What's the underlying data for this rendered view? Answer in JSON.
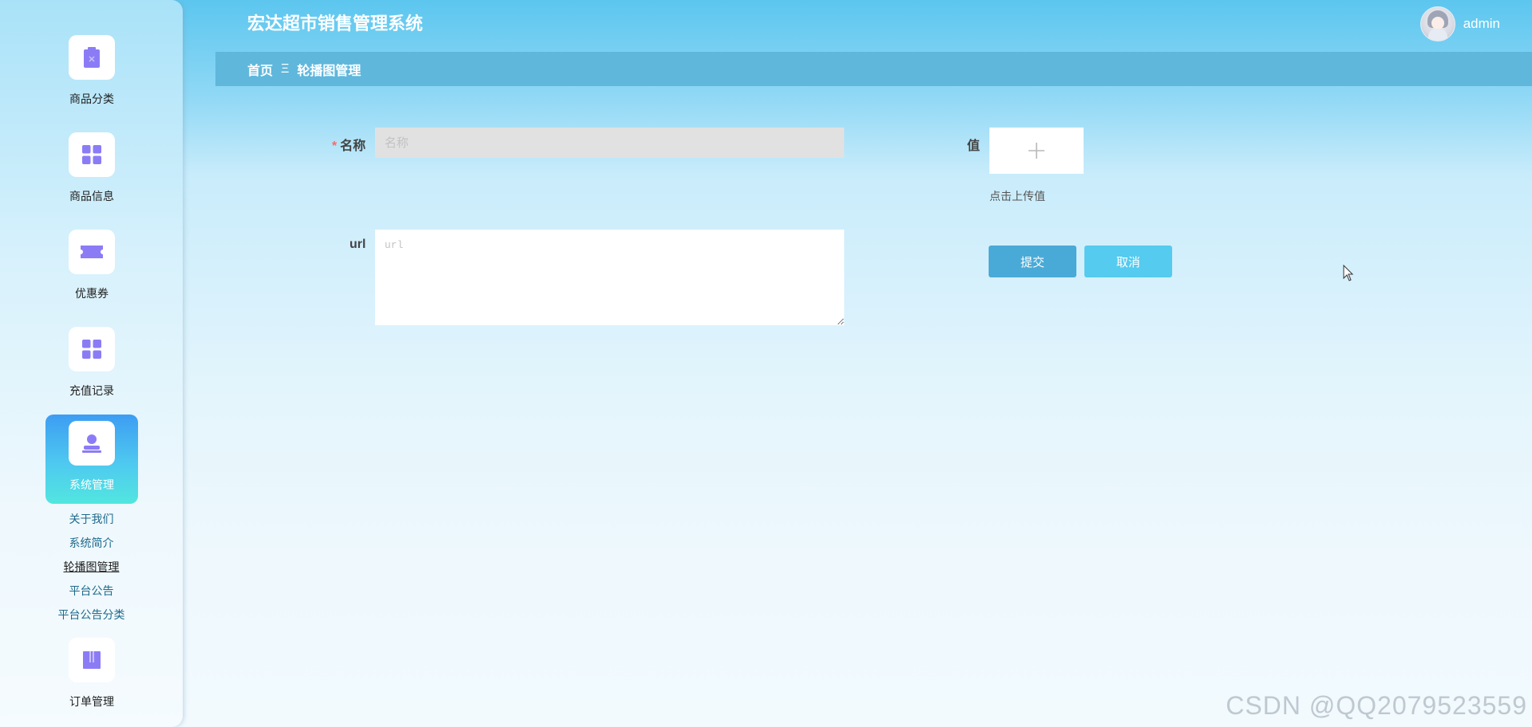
{
  "app": {
    "title": "宏达超市销售管理系统",
    "username": "admin"
  },
  "sidebar": {
    "items": [
      {
        "label": "商品分类",
        "icon": "clipboard-icon",
        "active": false
      },
      {
        "label": "商品信息",
        "icon": "grid-icon",
        "active": false
      },
      {
        "label": "优惠券",
        "icon": "ticket-icon",
        "active": false
      },
      {
        "label": "充值记录",
        "icon": "grid-icon",
        "active": false
      },
      {
        "label": "系统管理",
        "icon": "user-icon",
        "active": true
      },
      {
        "label": "订单管理",
        "icon": "book-icon",
        "active": false
      }
    ],
    "submenu": [
      {
        "label": "关于我们",
        "current": false
      },
      {
        "label": "系统简介",
        "current": false
      },
      {
        "label": "轮播图管理",
        "current": true
      },
      {
        "label": "平台公告",
        "current": false
      },
      {
        "label": "平台公告分类",
        "current": false
      }
    ]
  },
  "breadcrumb": {
    "home": "首页",
    "separator": "Ξ",
    "current": "轮播图管理"
  },
  "form": {
    "name": {
      "required_mark": "*",
      "label": "名称",
      "placeholder": "名称",
      "value": ""
    },
    "url": {
      "label": "url",
      "placeholder": "url",
      "value": ""
    },
    "value": {
      "label": "值",
      "upload_hint": "点击上传值",
      "upload_glyph": "+"
    },
    "submit_label": "提交",
    "cancel_label": "取消"
  },
  "watermark": "CSDN @QQ2079523559",
  "colors": {
    "accent": "#4aaad7",
    "cancel": "#55cbef",
    "breadcrumb_bg": "#5fb7dc",
    "icon_purple": "#8b7cf6",
    "required": "#f56c6c"
  }
}
